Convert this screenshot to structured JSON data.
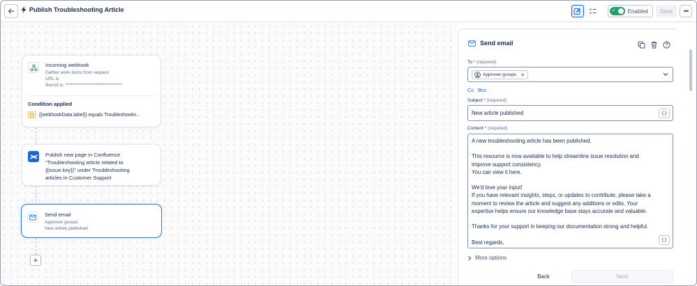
{
  "header": {
    "title": "Publish Troubleshooting Article",
    "enabled_label": "Enabled",
    "save_label": "Save"
  },
  "canvas": {
    "trigger": {
      "title": "Incoming webhook",
      "desc": "Gather work items from request",
      "url_line": "URL is:",
      "secret_line": "Secret is: ********************************",
      "condition_heading": "Condition applied",
      "condition_text": "{{webhookData.label}} equals Troubleshootin..."
    },
    "confluence": {
      "text_lines": [
        "Publish new page in Confluence",
        "\"Troubleshooting article related to",
        "{{issue.key}}\" under Troubleshooting",
        "articles in Customer Support"
      ]
    },
    "email": {
      "title": "Send email",
      "line1": "Approver groups",
      "line2": "New article published"
    }
  },
  "panel": {
    "title": "Send email",
    "to_label": "To",
    "required": "(required)",
    "to_chip": "Approver groups",
    "cc_label": "Cc",
    "bcc_label": "Bcc",
    "subject_label": "Subject",
    "subject_value": "New article published",
    "content_label": "Content",
    "content_value": "A new troubleshooting article has been published.\n\nThis resource is now available to help streamline issue resolution and\nimprove support consistency.\nYou can view it here.\n\nWe'd love your input!\nIf you have relevant insights, steps, or updates to contribute, please take a\nmoment to review the article and suggest any additions or edits. Your\nexpertise helps ensure our knowledge base stays accurate and valuable.\n\nThanks for your support in keeping our documentation strong and helpful.\n\nBest regards,",
    "more_options": "More options",
    "back_label": "Back",
    "next_label": "Next"
  },
  "colors": {
    "accent": "#0c66e4",
    "toggle_on": "#22a06b",
    "confluence": "#1868db",
    "required_star": "#c9372c"
  }
}
